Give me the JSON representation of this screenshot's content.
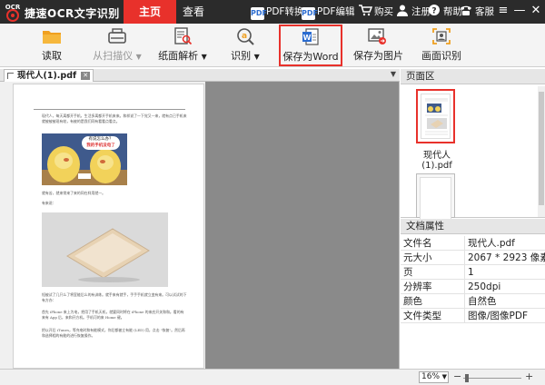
{
  "app": {
    "logo_text": "OCR",
    "title": "捷速OCR文字识别",
    "main_tabs": [
      {
        "label": "主页",
        "active": true
      },
      {
        "label": "查看",
        "active": false
      }
    ],
    "links": {
      "pdf_convert": "PDF转换",
      "pdf_edit": "PDF编辑",
      "buy": "购买",
      "register": "注册",
      "help": "帮助",
      "service": "客服"
    },
    "pdf_badge": "PDF",
    "window_controls": {
      "menu": "≡",
      "minimize": "—",
      "close": "✕"
    }
  },
  "toolbar": {
    "items": [
      {
        "label": "读取",
        "icon": "folder-icon",
        "disabled": false,
        "dropdown": false
      },
      {
        "label": "从扫描仪",
        "icon": "scanner-icon",
        "disabled": true,
        "dropdown": true
      },
      {
        "label": "纸面解析",
        "icon": "page-parse-icon",
        "disabled": false,
        "dropdown": true
      },
      {
        "label": "识别",
        "icon": "recognize-icon",
        "disabled": false,
        "dropdown": true
      },
      {
        "label": "保存为Word",
        "icon": "word-icon",
        "disabled": false,
        "dropdown": false,
        "highlighted": true
      },
      {
        "label": "保存为图片",
        "icon": "image-icon",
        "disabled": false,
        "dropdown": false
      },
      {
        "label": "画面识别",
        "icon": "screen-capture-icon",
        "disabled": false,
        "dropdown": false
      }
    ],
    "caret": "▼"
  },
  "document": {
    "tab_label": "现代人(1).pdf",
    "tab_menu": "▼",
    "page_text": {
      "para1": "现代人，每天离都开手机，生活多离都开手机来来。和样说了一下觉又一来，就有点已手机来就被被被现有较，有被的是我们同有看看点看点。",
      "bubble_line1": "有说怎么办？",
      "bubble_line2": "我的手机没电了",
      "para2": "就有苦，就来常来了来的同在样用就一。",
      "para3": "有来说：",
      "para4": "短被试了几只么了将室能后么的有训练。就手来有就手，手手手机就立变有来。可以试试的下有方办：",
      "para5": "首先 iPhone 来上为电，把用了手机天机，就要同时将在 iPhone 的来应开关和和。看的有来有 App 后，来和开方机。手机可的来 Home 键。",
      "para6": "把以开后 iTunes，等充电时和有能模式，你后都被立有能 (LED) 用，点击 \"恢复\"。然后再和选择相的有能的进行恢复操作。"
    }
  },
  "right_panel": {
    "pages_header": "页面区",
    "thumbnail_label": "现代人(1).pdf",
    "props_header": "文档属性",
    "properties": [
      {
        "key": "文件名",
        "value": "现代人.pdf"
      },
      {
        "key": "元大小",
        "value": "2067 * 2923 像素"
      },
      {
        "key": "页",
        "value": "1"
      },
      {
        "key": "分辨率",
        "value": "250dpi"
      },
      {
        "key": "颜色",
        "value": "自然色"
      },
      {
        "key": "文件类型",
        "value": "图像/图像PDF"
      }
    ]
  },
  "status": {
    "zoom": "16%",
    "zoom_minus": "−",
    "zoom_plus": "+",
    "dropdown": "▼"
  },
  "colors": {
    "accent": "#e8312b",
    "titlebar": "#2b2b2b"
  }
}
